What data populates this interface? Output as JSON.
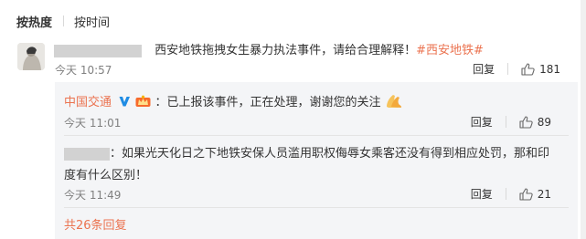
{
  "sort": {
    "active": "按热度",
    "inactive": "按时间"
  },
  "comment": {
    "text": "西安地铁拖拽女生暴力执法事件，请给合理解释！",
    "hashtag": "#西安地铁#",
    "time": "今天 10:57",
    "reply_label": "回复",
    "likes": "181"
  },
  "replies": [
    {
      "nick": "中国交通",
      "text": "：已上报该事件，正在处理，谢谢您的关注",
      "time": "今天 11:01",
      "reply_label": "回复",
      "likes": "89"
    },
    {
      "text_line1": "：如果光天化日之下地铁安保人员滥用职权侮辱女乘客还没有得到相应处罚，那和印",
      "text_line2": "度有什么区别！",
      "time": "今天 11:49",
      "reply_label": "回复",
      "likes": "21"
    }
  ],
  "more_replies": "共26条回复",
  "colors": {
    "link": "#eb7350",
    "verified": "#1f8ce4",
    "text": "#333333",
    "time": "#808080",
    "reply_bg": "#f4f5f7"
  }
}
